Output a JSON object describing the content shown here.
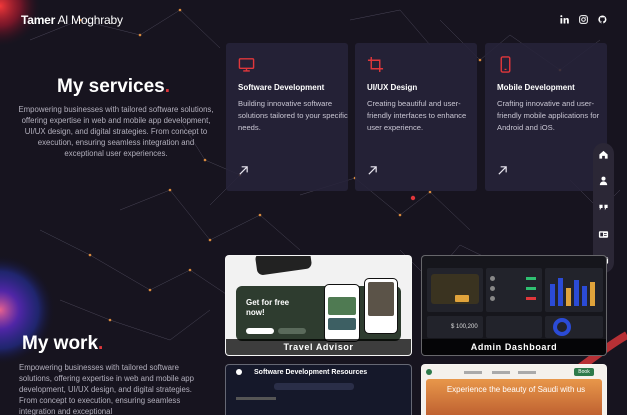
{
  "header": {
    "name_first": "Tamer",
    "name_last": " Al Moghraby",
    "socials": [
      "linkedin-icon",
      "instagram-icon",
      "github-icon"
    ]
  },
  "services": {
    "title": "My services",
    "title_dot": ".",
    "description": "Empowering businesses with tailored software solutions, offering expertise in web and mobile app development, UI/UX design, and digital strategies. From concept to execution, ensuring seamless integration and exceptional user experiences.",
    "cards": [
      {
        "icon": "monitor-icon",
        "title": "Software Development",
        "text": "Building innovative software solutions tailored to your specific needs."
      },
      {
        "icon": "crop-icon",
        "title": "UI/UX Design",
        "text": "Creating beautiful and user-friendly interfaces to enhance user experience."
      },
      {
        "icon": "mobile-icon",
        "title": "Mobile Development",
        "text": "Crafting innovative and user-friendly mobile applications for Android and iOS."
      }
    ]
  },
  "side_nav": [
    "home-icon",
    "user-icon",
    "quote-icon",
    "id-card-icon",
    "mail-icon"
  ],
  "work": {
    "title": "My work",
    "title_dot": ".",
    "description": "Empowering businesses with tailored software solutions, offering expertise in web and mobile app development, UI/UX design, and digital strategies. From concept to execution, ensuring seamless integration and exceptional",
    "projects": [
      {
        "caption": "Travel Advisor",
        "headline": "Get for free now!"
      },
      {
        "caption": "Admin Dashboard",
        "amount": "$ 100,200"
      },
      {
        "header": "Software Development Resources"
      },
      {
        "headline": "Experience the beauty of Saudi with us",
        "button": "Book"
      }
    ]
  },
  "colors": {
    "accent": "#e0373b",
    "background": "#17141f",
    "card": "#27233a"
  }
}
